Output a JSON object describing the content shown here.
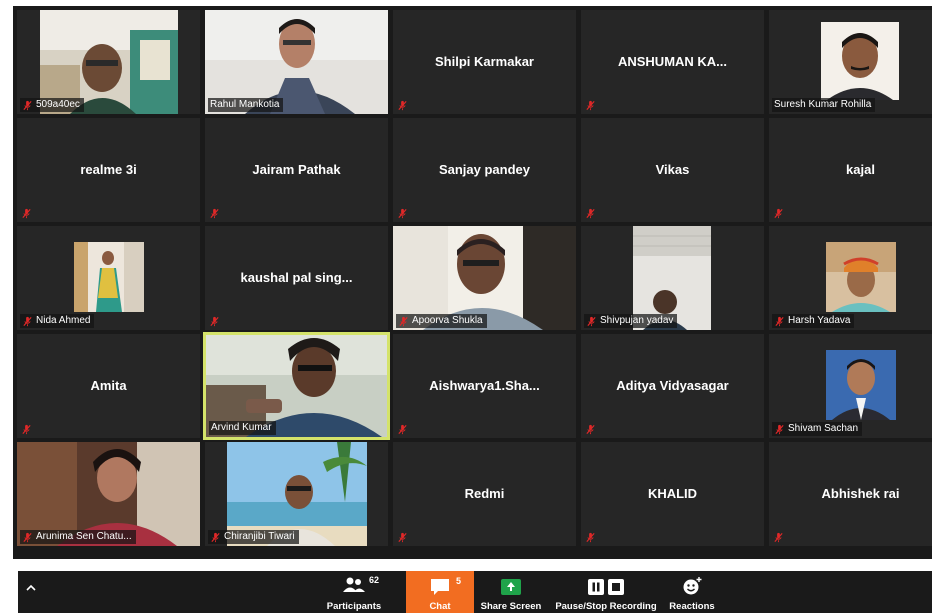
{
  "colors": {
    "grid_bg": "#1a1a1a",
    "tile_bg": "#262626",
    "active_border": "#d4e36a",
    "mute_red": "#e02828",
    "chat_orange": "#f26d21",
    "share_green": "#1fa34a"
  },
  "participants": [
    {
      "name": "509a40ec",
      "video": true
    },
    {
      "name": "Rahul Mankotia",
      "video": true
    },
    {
      "name": "Shilpi Karmakar",
      "video": false
    },
    {
      "name": "ANSHUMAN  KA...",
      "video": false
    },
    {
      "name": "Suresh Kumar Rohilla",
      "video": true
    },
    {
      "name": "realme 3i",
      "video": false
    },
    {
      "name": "Jairam Pathak",
      "video": false
    },
    {
      "name": "Sanjay pandey",
      "video": false
    },
    {
      "name": "Vikas",
      "video": false
    },
    {
      "name": "kajal",
      "video": false
    },
    {
      "name": "Nida Ahmed",
      "video": true
    },
    {
      "name": "kaushal  pal  sing...",
      "video": false
    },
    {
      "name": "Apoorva Shukla",
      "video": true
    },
    {
      "name": "Shivpujan yadav",
      "video": true
    },
    {
      "name": "Harsh Yadava",
      "video": true
    },
    {
      "name": "Amita",
      "video": false
    },
    {
      "name": "Arvind Kumar",
      "video": true,
      "active": true
    },
    {
      "name": "Aishwarya1.Sha...",
      "video": false
    },
    {
      "name": "Aditya Vidyasagar",
      "video": false
    },
    {
      "name": "Shivam Sachan",
      "video": true
    },
    {
      "name": "Arunima Sen Chatu...",
      "video": true
    },
    {
      "name": "Chiranjibi Tiwari",
      "video": true
    },
    {
      "name": "Redmi",
      "video": false
    },
    {
      "name": "KHALID",
      "video": false
    },
    {
      "name": "Abhishek rai",
      "video": false
    }
  ],
  "toolbar": {
    "participants_label": "Participants",
    "participants_count": "62",
    "chat_label": "Chat",
    "chat_count": "5",
    "share_label": "Share Screen",
    "recording_label": "Pause/Stop Recording",
    "reactions_label": "Reactions"
  }
}
